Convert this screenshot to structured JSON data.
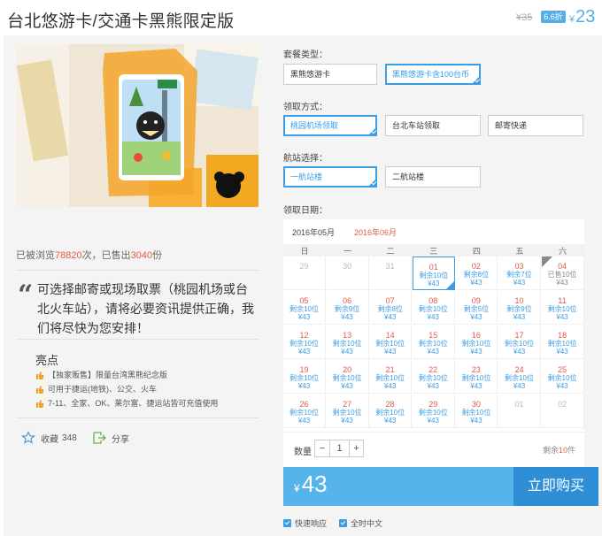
{
  "header": {
    "title": "台北悠游卡/交通卡黑熊限定版",
    "price_old": "¥35",
    "discount": "6.6折",
    "price_now_symbol": "¥",
    "price_now": "23"
  },
  "left": {
    "stats_prefix": "已被浏览",
    "stats_views": "78820",
    "stats_mid": "次，已售出",
    "stats_sold": "3040",
    "stats_suffix": "份",
    "quote": "可选择邮寄或现场取票（桃园机场或台北火车站），请将必要资讯提供正确，我们将尽快为您安排！",
    "highlights_title": "亮点",
    "highlights": [
      "【独家贩售】限量台湾黑熊纪念版",
      "可用于捷运(地铁)、公交、火车",
      "7-11、全家、OK、莱尔富、捷运站皆可充值使用"
    ],
    "favorite_label": "收藏",
    "favorite_count": "348",
    "share_label": "分享"
  },
  "options": {
    "package_label": "套餐类型：",
    "package": [
      "黑熊悠游卡",
      "黑熊悠游卡含100台币"
    ],
    "pickup_label": "领取方式：",
    "pickup": [
      "桃园机场领取",
      "台北车站领取",
      "邮寄快递"
    ],
    "terminal_label": "航站选择：",
    "terminal": [
      "一航站楼",
      "二航站楼"
    ],
    "date_label": "领取日期："
  },
  "calendar": {
    "months": [
      "2016年05月",
      "2016年06月"
    ],
    "weekdays": [
      "日",
      "一",
      "二",
      "三",
      "四",
      "五",
      "六"
    ],
    "rows": [
      [
        {
          "d": "29"
        },
        {
          "d": "30"
        },
        {
          "d": "31"
        },
        {
          "d": "01",
          "l": "剩余10位",
          "p": "¥43"
        },
        {
          "d": "02",
          "l": "剩余8位",
          "p": "¥43"
        },
        {
          "d": "03",
          "l": "剩余7位",
          "p": "¥43"
        },
        {
          "d": "04",
          "l": "已售10位",
          "p": "¥43"
        }
      ],
      [
        {
          "d": "05",
          "l": "剩余10位",
          "p": "¥43"
        },
        {
          "d": "06",
          "l": "剩余9位",
          "p": "¥43"
        },
        {
          "d": "07",
          "l": "剩余8位",
          "p": "¥43"
        },
        {
          "d": "08",
          "l": "剩余10位",
          "p": "¥43"
        },
        {
          "d": "09",
          "l": "剩余5位",
          "p": "¥43"
        },
        {
          "d": "10",
          "l": "剩余9位",
          "p": "¥43"
        },
        {
          "d": "11",
          "l": "剩余10位",
          "p": "¥43"
        }
      ],
      [
        {
          "d": "12",
          "l": "剩余10位",
          "p": "¥43"
        },
        {
          "d": "13",
          "l": "剩余10位",
          "p": "¥43"
        },
        {
          "d": "14",
          "l": "剩余10位",
          "p": "¥43"
        },
        {
          "d": "15",
          "l": "剩余10位",
          "p": "¥43"
        },
        {
          "d": "16",
          "l": "剩余10位",
          "p": "¥43"
        },
        {
          "d": "17",
          "l": "剩余10位",
          "p": "¥43"
        },
        {
          "d": "18",
          "l": "剩余10位",
          "p": "¥43"
        }
      ],
      [
        {
          "d": "19",
          "l": "剩余10位",
          "p": "¥43"
        },
        {
          "d": "20",
          "l": "剩余10位",
          "p": "¥43"
        },
        {
          "d": "21",
          "l": "剩余10位",
          "p": "¥43"
        },
        {
          "d": "22",
          "l": "剩余10位",
          "p": "¥43"
        },
        {
          "d": "23",
          "l": "剩余10位",
          "p": "¥43"
        },
        {
          "d": "24",
          "l": "剩余10位",
          "p": "¥43"
        },
        {
          "d": "25",
          "l": "剩余10位",
          "p": "¥43"
        }
      ],
      [
        {
          "d": "26",
          "l": "剩余10位",
          "p": "¥43"
        },
        {
          "d": "27",
          "l": "剩余10位",
          "p": "¥43"
        },
        {
          "d": "28",
          "l": "剩余10位",
          "p": "¥43"
        },
        {
          "d": "29",
          "l": "剩余10位",
          "p": "¥43"
        },
        {
          "d": "30",
          "l": "剩余10位",
          "p": "¥43"
        },
        {
          "d": "01"
        },
        {
          "d": "02"
        }
      ]
    ]
  },
  "purchase": {
    "qty_label": "数量",
    "minus": "−",
    "qty": "1",
    "plus": "+",
    "remain_prefix": "剩余",
    "remain_num": "10",
    "remain_suffix": "件",
    "total_symbol": "¥",
    "total": "43",
    "buy_label": "立即购买",
    "badges": [
      "快速响应",
      "全时中文"
    ]
  },
  "colors": {
    "accent": "#3a9de6",
    "buy_bar": "#56b4ea",
    "buy_button": "#2e8fd6",
    "highlight_red": "#e25b45"
  }
}
